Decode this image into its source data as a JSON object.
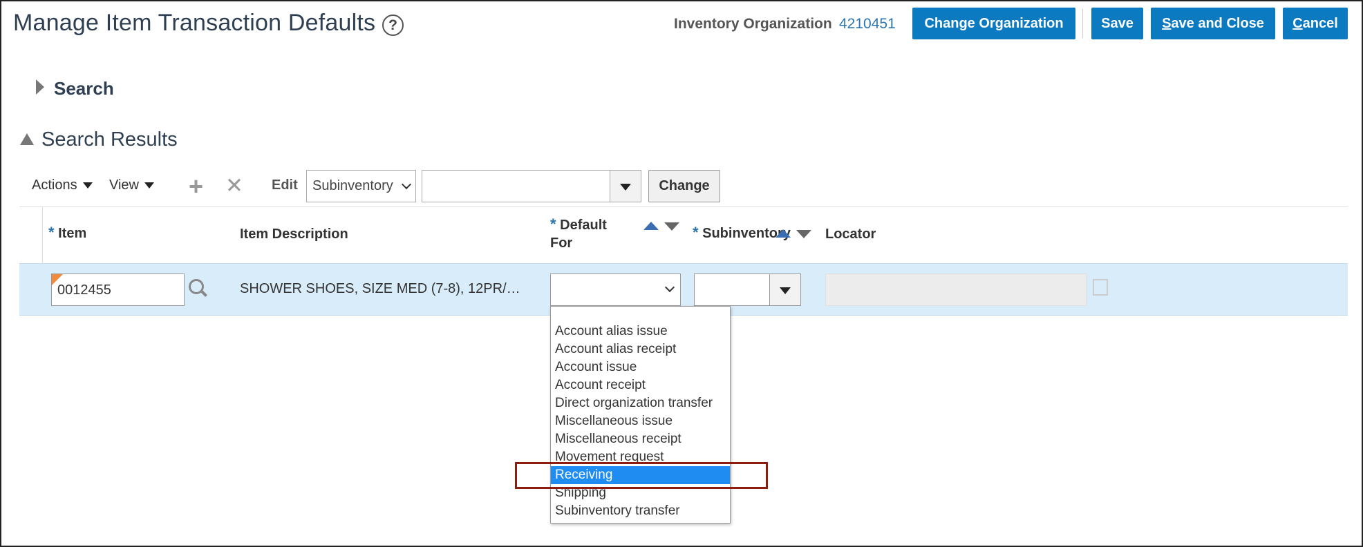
{
  "header": {
    "title": "Manage Item Transaction Defaults",
    "help": "?",
    "org_label": "Inventory Organization",
    "org_value": "4210451",
    "btn_change_org": "Change Organization",
    "btn_save": "Save",
    "btn_save_close_first": "S",
    "btn_save_close_rest": "ave and Close",
    "btn_cancel_first": "C",
    "btn_cancel_rest": "ancel"
  },
  "sections": {
    "search": "Search",
    "results": "Search Results"
  },
  "toolbar": {
    "actions": "Actions",
    "view": "View",
    "add": "+",
    "remove": "✕",
    "edit_label": "Edit",
    "edit_field": "Subinventory",
    "change_button": "Change"
  },
  "table": {
    "columns": {
      "item": "Item",
      "description": "Item Description",
      "default_for_line1": "Default",
      "default_for_line2": "For",
      "subinventory": "Subinventory",
      "locator": "Locator"
    },
    "required_marker": "*",
    "row": {
      "item": "0012455",
      "description": "SHOWER SHOES, SIZE MED (7-8), 12PR/…"
    }
  },
  "dropdown": {
    "options": [
      "",
      "Account alias issue",
      "Account alias receipt",
      "Account issue",
      "Account receipt",
      "Direct organization transfer",
      "Miscellaneous issue",
      "Miscellaneous receipt",
      "Movement request",
      "Receiving",
      "Shipping",
      "Subinventory transfer"
    ],
    "selected": "Receiving"
  },
  "colors": {
    "accent": "#0c7ac0",
    "row_selected": "#d9ecf9",
    "option_selected": "#1e8cf0",
    "highlight_box": "#8b1e0e"
  }
}
